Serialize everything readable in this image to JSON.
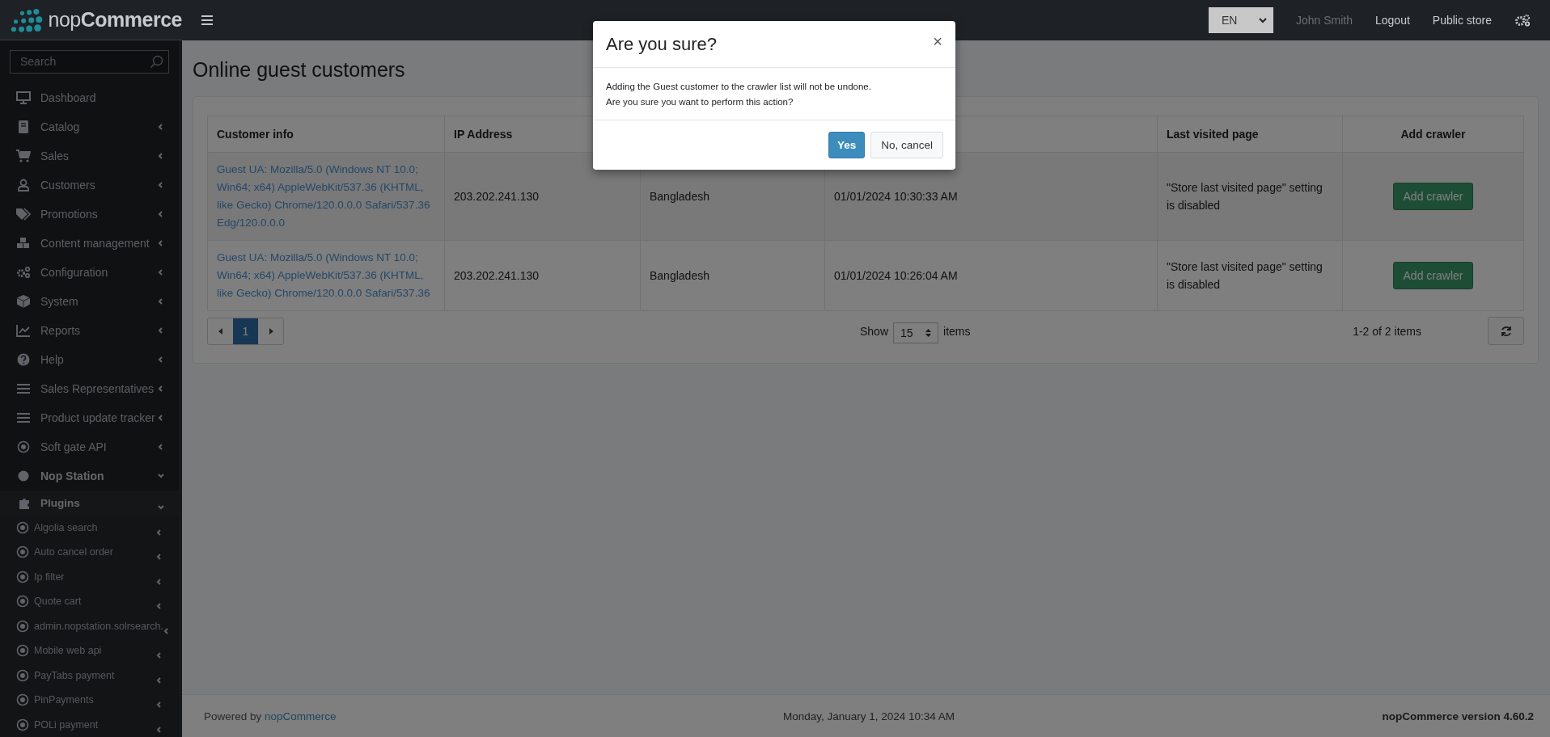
{
  "brand": {
    "prefix": "nop",
    "name": "Commerce"
  },
  "sidebar": {
    "search": {
      "placeholder": "Search"
    },
    "items": [
      {
        "label": "Dashboard",
        "kind": "link"
      },
      {
        "label": "Catalog",
        "kind": "group",
        "expanded": false
      },
      {
        "label": "Sales",
        "kind": "group",
        "expanded": false
      },
      {
        "label": "Customers",
        "kind": "group",
        "expanded": false
      },
      {
        "label": "Promotions",
        "kind": "group",
        "expanded": false
      },
      {
        "label": "Content management",
        "kind": "group",
        "expanded": false
      },
      {
        "label": "Configuration",
        "kind": "group",
        "expanded": false
      },
      {
        "label": "System",
        "kind": "group",
        "expanded": false
      },
      {
        "label": "Reports",
        "kind": "group",
        "expanded": false
      },
      {
        "label": "Help",
        "kind": "group",
        "expanded": false
      },
      {
        "label": "Sales Representatives",
        "kind": "group",
        "expanded": false
      },
      {
        "label": "Product update tracker",
        "kind": "group",
        "expanded": false
      },
      {
        "label": "Soft gate API",
        "kind": "group",
        "expanded": false
      },
      {
        "label": "Nop Station",
        "kind": "group",
        "expanded": true,
        "children": [
          {
            "label": "Plugins",
            "expanded": true,
            "children": [
              {
                "label": "Algolia search",
                "expanded": false
              },
              {
                "label": "Auto cancel order",
                "expanded": false
              },
              {
                "label": "Ip filter",
                "expanded": false
              },
              {
                "label": "Quote cart",
                "expanded": false
              },
              {
                "label": "admin.nopstation.solrsearch.",
                "expanded": false
              },
              {
                "label": "Mobile web api",
                "expanded": false
              },
              {
                "label": "PayTabs payment",
                "expanded": false
              },
              {
                "label": "PinPayments",
                "expanded": false
              },
              {
                "label": "POLi payment",
                "expanded": false
              }
            ]
          }
        ]
      }
    ]
  },
  "topbar": {
    "language": "EN",
    "user": "John Smith",
    "logout": "Logout",
    "public_store": "Public store"
  },
  "page": {
    "title": "Online guest customers"
  },
  "table": {
    "columns": {
      "customer_info": "Customer info",
      "ip_address": "IP Address",
      "last_visited_page": "Last visited page",
      "add_crawler": "Add crawler"
    },
    "rows": [
      {
        "customer_info": "Guest UA: Mozilla/5.0 (Windows NT 10.0; Win64; x64) AppleWebKit/537.36 (KHTML, like Gecko) Chrome/120.0.0.0 Safari/537.36 Edg/120.0.0.0",
        "ip_address": "203.202.241.130",
        "location": "Bangladesh",
        "last_activity": "01/01/2024 10:30:33 AM",
        "last_visited_page": "\"Store last visited page\" setting is disabled",
        "action": "Add crawler"
      },
      {
        "customer_info": "Guest UA: Mozilla/5.0 (Windows NT 10.0; Win64; x64) AppleWebKit/537.36 (KHTML, like Gecko) Chrome/120.0.0.0 Safari/537.36",
        "ip_address": "203.202.241.130",
        "location": "Bangladesh",
        "last_activity": "01/01/2024 10:26:04 AM",
        "last_visited_page": "\"Store last visited page\" setting is disabled",
        "action": "Add crawler"
      }
    ]
  },
  "pager": {
    "pages": [
      {
        "label": "1",
        "selected": true
      }
    ],
    "show_label": "Show",
    "page_size": "15",
    "items_label": "items",
    "summary": "1-2 of 2 items"
  },
  "footer": {
    "powered_by": "Powered by",
    "powered_link": "nopCommerce",
    "date": "Monday, January 1, 2024 10:34 AM",
    "version": "nopCommerce version 4.60.2"
  },
  "modal": {
    "title": "Are you sure?",
    "close": "×",
    "lines": [
      "Adding the Guest customer to the crawler list will not be undone.",
      "Are you sure you want to perform this action?"
    ],
    "yes": "Yes",
    "cancel": "No, cancel"
  }
}
